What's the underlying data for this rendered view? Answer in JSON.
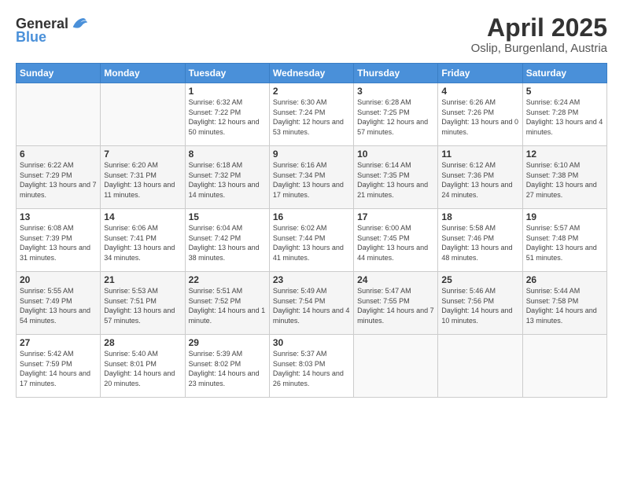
{
  "header": {
    "logo": {
      "general": "General",
      "blue": "Blue"
    },
    "title": "April 2025",
    "subtitle": "Oslip, Burgenland, Austria"
  },
  "calendar": {
    "weekdays": [
      "Sunday",
      "Monday",
      "Tuesday",
      "Wednesday",
      "Thursday",
      "Friday",
      "Saturday"
    ],
    "weeks": [
      [
        {
          "day": null
        },
        {
          "day": null
        },
        {
          "day": "1",
          "sunrise": "6:32 AM",
          "sunset": "7:22 PM",
          "daylight": "12 hours and 50 minutes."
        },
        {
          "day": "2",
          "sunrise": "6:30 AM",
          "sunset": "7:24 PM",
          "daylight": "12 hours and 53 minutes."
        },
        {
          "day": "3",
          "sunrise": "6:28 AM",
          "sunset": "7:25 PM",
          "daylight": "12 hours and 57 minutes."
        },
        {
          "day": "4",
          "sunrise": "6:26 AM",
          "sunset": "7:26 PM",
          "daylight": "13 hours and 0 minutes."
        },
        {
          "day": "5",
          "sunrise": "6:24 AM",
          "sunset": "7:28 PM",
          "daylight": "13 hours and 4 minutes."
        }
      ],
      [
        {
          "day": "6",
          "sunrise": "6:22 AM",
          "sunset": "7:29 PM",
          "daylight": "13 hours and 7 minutes."
        },
        {
          "day": "7",
          "sunrise": "6:20 AM",
          "sunset": "7:31 PM",
          "daylight": "13 hours and 11 minutes."
        },
        {
          "day": "8",
          "sunrise": "6:18 AM",
          "sunset": "7:32 PM",
          "daylight": "13 hours and 14 minutes."
        },
        {
          "day": "9",
          "sunrise": "6:16 AM",
          "sunset": "7:34 PM",
          "daylight": "13 hours and 17 minutes."
        },
        {
          "day": "10",
          "sunrise": "6:14 AM",
          "sunset": "7:35 PM",
          "daylight": "13 hours and 21 minutes."
        },
        {
          "day": "11",
          "sunrise": "6:12 AM",
          "sunset": "7:36 PM",
          "daylight": "13 hours and 24 minutes."
        },
        {
          "day": "12",
          "sunrise": "6:10 AM",
          "sunset": "7:38 PM",
          "daylight": "13 hours and 27 minutes."
        }
      ],
      [
        {
          "day": "13",
          "sunrise": "6:08 AM",
          "sunset": "7:39 PM",
          "daylight": "13 hours and 31 minutes."
        },
        {
          "day": "14",
          "sunrise": "6:06 AM",
          "sunset": "7:41 PM",
          "daylight": "13 hours and 34 minutes."
        },
        {
          "day": "15",
          "sunrise": "6:04 AM",
          "sunset": "7:42 PM",
          "daylight": "13 hours and 38 minutes."
        },
        {
          "day": "16",
          "sunrise": "6:02 AM",
          "sunset": "7:44 PM",
          "daylight": "13 hours and 41 minutes."
        },
        {
          "day": "17",
          "sunrise": "6:00 AM",
          "sunset": "7:45 PM",
          "daylight": "13 hours and 44 minutes."
        },
        {
          "day": "18",
          "sunrise": "5:58 AM",
          "sunset": "7:46 PM",
          "daylight": "13 hours and 48 minutes."
        },
        {
          "day": "19",
          "sunrise": "5:57 AM",
          "sunset": "7:48 PM",
          "daylight": "13 hours and 51 minutes."
        }
      ],
      [
        {
          "day": "20",
          "sunrise": "5:55 AM",
          "sunset": "7:49 PM",
          "daylight": "13 hours and 54 minutes."
        },
        {
          "day": "21",
          "sunrise": "5:53 AM",
          "sunset": "7:51 PM",
          "daylight": "13 hours and 57 minutes."
        },
        {
          "day": "22",
          "sunrise": "5:51 AM",
          "sunset": "7:52 PM",
          "daylight": "14 hours and 1 minute."
        },
        {
          "day": "23",
          "sunrise": "5:49 AM",
          "sunset": "7:54 PM",
          "daylight": "14 hours and 4 minutes."
        },
        {
          "day": "24",
          "sunrise": "5:47 AM",
          "sunset": "7:55 PM",
          "daylight": "14 hours and 7 minutes."
        },
        {
          "day": "25",
          "sunrise": "5:46 AM",
          "sunset": "7:56 PM",
          "daylight": "14 hours and 10 minutes."
        },
        {
          "day": "26",
          "sunrise": "5:44 AM",
          "sunset": "7:58 PM",
          "daylight": "14 hours and 13 minutes."
        }
      ],
      [
        {
          "day": "27",
          "sunrise": "5:42 AM",
          "sunset": "7:59 PM",
          "daylight": "14 hours and 17 minutes."
        },
        {
          "day": "28",
          "sunrise": "5:40 AM",
          "sunset": "8:01 PM",
          "daylight": "14 hours and 20 minutes."
        },
        {
          "day": "29",
          "sunrise": "5:39 AM",
          "sunset": "8:02 PM",
          "daylight": "14 hours and 23 minutes."
        },
        {
          "day": "30",
          "sunrise": "5:37 AM",
          "sunset": "8:03 PM",
          "daylight": "14 hours and 26 minutes."
        },
        {
          "day": null
        },
        {
          "day": null
        },
        {
          "day": null
        }
      ]
    ]
  }
}
